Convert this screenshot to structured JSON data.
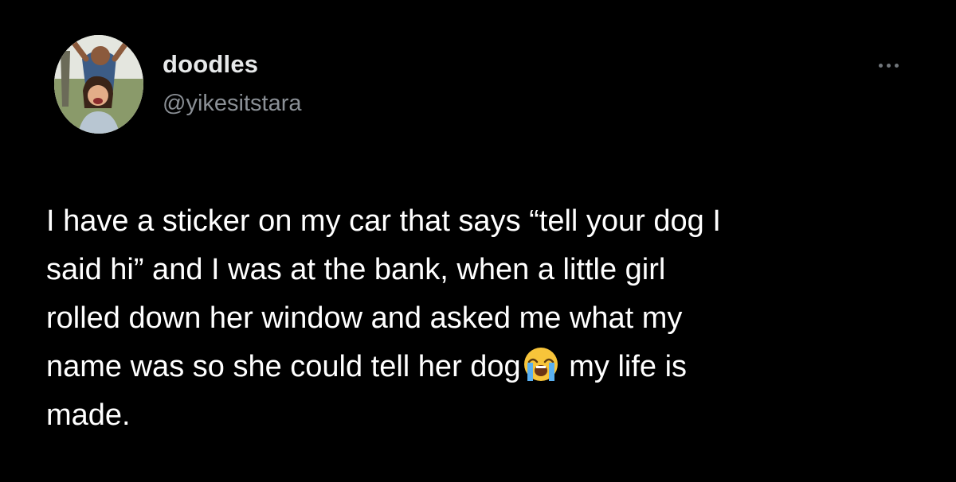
{
  "author": {
    "display_name": "doodles",
    "handle": "@yikesitstara",
    "avatar_icon": "profile-photo-avatar"
  },
  "more_icon": "more-options-icon",
  "tweet": {
    "text_before_emoji": "I have a sticker on my car that says “tell your dog I\nsaid hi” and I was at the bank, when a little girl\nrolled down her window and asked me what my\nname was so she could tell her dog",
    "emoji": "loudly-crying-face",
    "text_after_emoji": " my life is\nmade."
  },
  "colors": {
    "background": "#000000",
    "text_primary": "#ffffff",
    "text_secondary": "#8b9096",
    "icon_muted": "#71767b"
  }
}
